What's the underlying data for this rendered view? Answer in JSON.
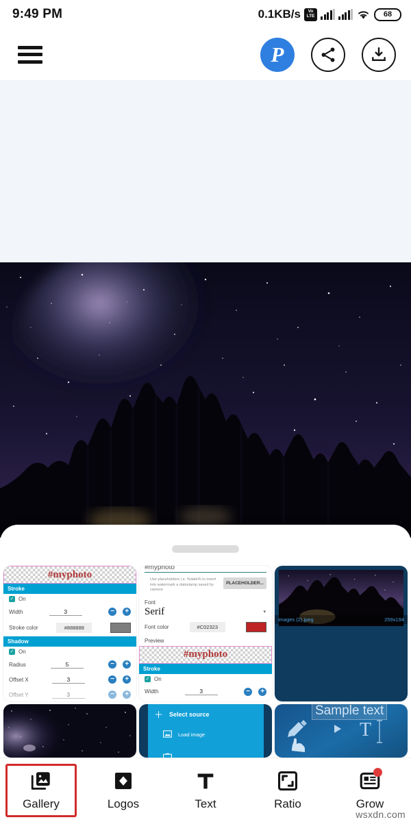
{
  "status_bar": {
    "time": "9:49 PM",
    "network_speed": "0.1KB/s",
    "volte_top": "Vo",
    "volte_bottom": "LTE",
    "battery_level": "68",
    "icons": [
      "volte-icon",
      "signal-bars-sim1-icon",
      "signal-bars-sim2-icon",
      "wifi-icon",
      "battery-icon"
    ]
  },
  "app_bar": {
    "menu_icon": "hamburger-menu-icon",
    "logo_letter": "P",
    "logo_name": "photo-app-logo",
    "share_icon": "share-icon",
    "download_icon": "download-icon"
  },
  "editor": {
    "canvas_background": "#f2f5fa",
    "photo_alt": "night-sky-over-pine-forest"
  },
  "sheet": {
    "grabber": "drag-handle",
    "thumbnails": [
      {
        "id": "thumb-stroke-shadow-settings",
        "type": "settings-screenshot",
        "watermark_text": "#myphoto",
        "sections": [
          {
            "title": "Stroke",
            "rows": [
              {
                "label": "On",
                "type": "checkbox",
                "checked": true
              },
              {
                "label": "Width",
                "value": "3",
                "type": "stepper"
              },
              {
                "label": "Stroke color",
                "value": "#888888",
                "type": "color",
                "swatch": "#7d7d7d"
              }
            ]
          },
          {
            "title": "Shadow",
            "rows": [
              {
                "label": "On",
                "type": "checkbox",
                "checked": true
              },
              {
                "label": "Radius",
                "value": "5",
                "type": "stepper"
              },
              {
                "label": "Offset X",
                "value": "3",
                "type": "stepper"
              },
              {
                "label": "Offset Y",
                "value": "3",
                "type": "stepper"
              }
            ]
          }
        ]
      },
      {
        "id": "thumb-font-settings",
        "type": "settings-screenshot",
        "field_value": "#myphoto",
        "hint": "Use placeholders i.e. %date% to insert into watermark a datestamp saved by camera",
        "placeholder_button": "PLACEHOLDER...",
        "font_label": "Font",
        "font_value": "Serif",
        "font_color_label": "Font color",
        "font_color_value": "#C02323",
        "font_color_swatch": "#c02323",
        "preview_label": "Preview",
        "preview_text": "#myphoto",
        "stroke_section": "Stroke",
        "stroke_on": "On",
        "width_label": "Width",
        "width_value": "3"
      },
      {
        "id": "thumb-image-info",
        "type": "image-screenshot",
        "file_name": "images (2).jpeg",
        "dimensions": "259x194"
      },
      {
        "id": "thumb-milkyway",
        "type": "photo",
        "alt": "milky-way-starfield"
      },
      {
        "id": "thumb-select-source",
        "type": "menu-screenshot",
        "title": "Select source",
        "item": "Load image"
      },
      {
        "id": "thumb-sample-text",
        "type": "tutorial-screenshot",
        "text": "Sample text"
      }
    ]
  },
  "bottom_nav": {
    "selected": "Gallery",
    "items": [
      {
        "label": "Gallery",
        "icon": "gallery-icon",
        "selected": true,
        "badge": false
      },
      {
        "label": "Logos",
        "icon": "diamond-logo-icon",
        "selected": false,
        "badge": false
      },
      {
        "label": "Text",
        "icon": "text-t-icon",
        "selected": false,
        "badge": false
      },
      {
        "label": "Ratio",
        "icon": "aspect-ratio-icon",
        "selected": false,
        "badge": false
      },
      {
        "label": "Grow",
        "icon": "grow-article-icon",
        "selected": false,
        "badge": true
      }
    ]
  },
  "watermark": {
    "text": "wsxdn.com"
  },
  "colors": {
    "accent_blue": "#2f7fe0",
    "panel_cyan": "#12a0d8",
    "highlight_red": "#d12b2b",
    "badge_red": "#e03b3b",
    "canvas": "#f2f5fa"
  }
}
